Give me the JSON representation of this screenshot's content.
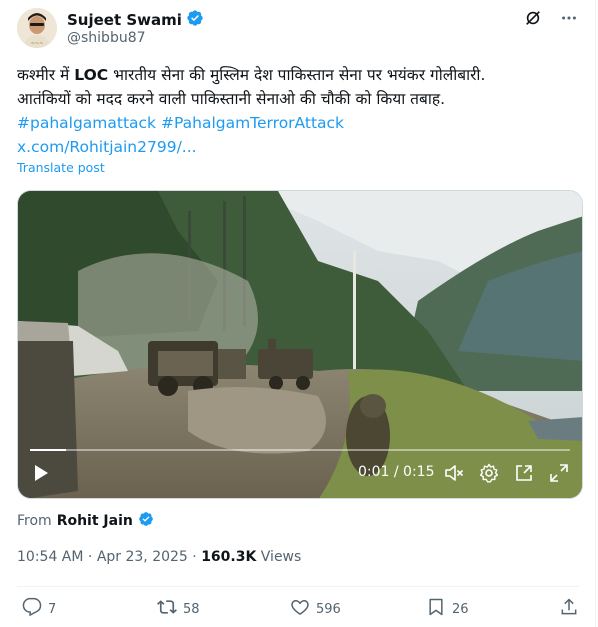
{
  "author": {
    "name": "Sujeet Swami",
    "handle": "@shibbu87",
    "verified_icon": "verified-badge-icon"
  },
  "post": {
    "line1_part1": "कश्मीर में ",
    "line1_bold": "LOC",
    "line1_part2": " भारतीय सेना की मुस्लिम देश पाकिस्तान सेना पर भयंकर गोलीबारी.",
    "line2": "आतंकियों को मदद करने वाली पाकिस्तानी सेनाओ की चौकी को किया तबाह.",
    "hashtag1": "#pahalgamattack",
    "hashtag2": "#PahalgamTerrorAttack",
    "link": "x.com/Rohitjain2799/...",
    "translate_label": "Translate post"
  },
  "video": {
    "time_display": "0:01 / 0:15",
    "progress": 0.066,
    "controls": [
      "play-icon",
      "mute-icon",
      "settings-icon",
      "pip-icon",
      "fullscreen-icon"
    ]
  },
  "source": {
    "prefix": "From",
    "name": "Rohit Jain"
  },
  "meta": {
    "time": "10:54 AM",
    "sep": "·",
    "date": "Apr 23, 2025",
    "views_count": "160.3K",
    "views_label": "Views"
  },
  "actions": {
    "replies": "7",
    "reposts": "58",
    "likes": "596",
    "bookmarks": "26"
  },
  "colors": {
    "accent": "#1d9bf0",
    "secondary_text": "#536471",
    "primary_text": "#0f1419"
  }
}
